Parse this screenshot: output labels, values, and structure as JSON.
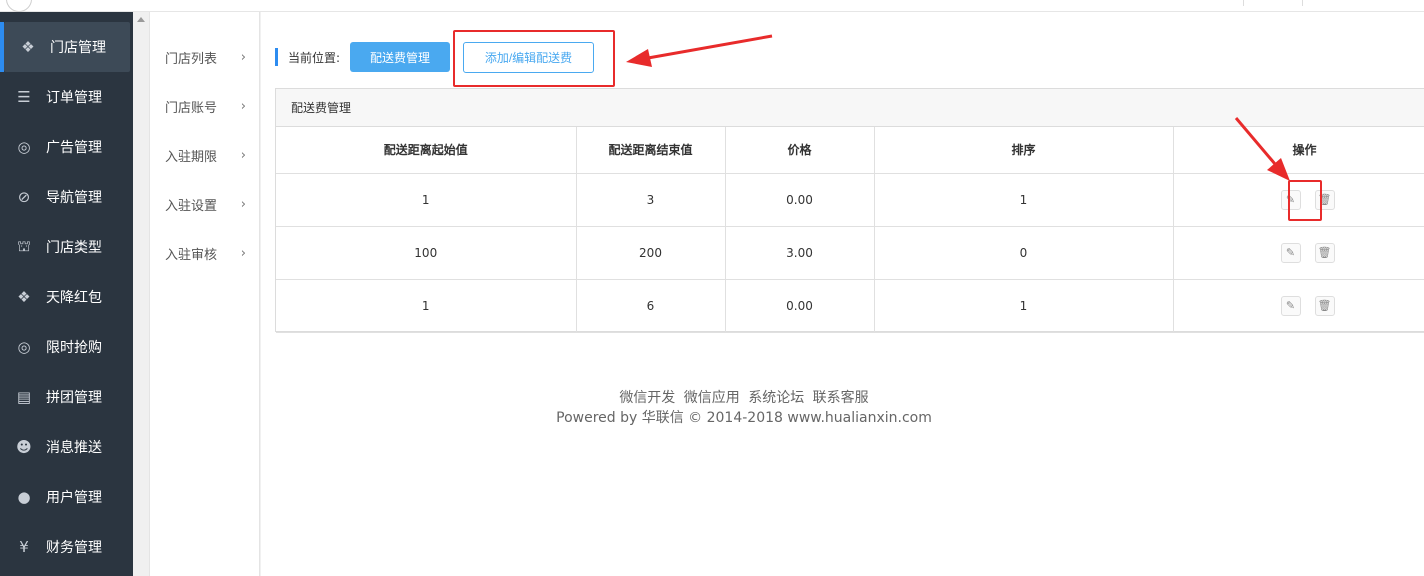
{
  "sidebar": {
    "items": [
      {
        "label": "门店管理",
        "icon": "cubes-icon",
        "glyph": "❖",
        "active": true
      },
      {
        "label": "订单管理",
        "icon": "list-icon",
        "glyph": "☰"
      },
      {
        "label": "广告管理",
        "icon": "lifebuoy-icon",
        "glyph": "◎"
      },
      {
        "label": "导航管理",
        "icon": "compass-icon",
        "glyph": "⊘"
      },
      {
        "label": "门店类型",
        "icon": "bank-icon",
        "glyph": "⛫"
      },
      {
        "label": "天降红包",
        "icon": "cubes-icon",
        "glyph": "❖"
      },
      {
        "label": "限时抢购",
        "icon": "lifebuoy-icon",
        "glyph": "◎"
      },
      {
        "label": "拼团管理",
        "icon": "newspaper-icon",
        "glyph": "▤"
      },
      {
        "label": "消息推送",
        "icon": "users-icon",
        "glyph": "☻"
      },
      {
        "label": "用户管理",
        "icon": "user-icon",
        "glyph": "●"
      },
      {
        "label": "财务管理",
        "icon": "yen-icon",
        "glyph": "¥"
      }
    ]
  },
  "subnav": {
    "items": [
      {
        "label": "门店列表"
      },
      {
        "label": "门店账号"
      },
      {
        "label": "入驻期限"
      },
      {
        "label": "入驻设置"
      },
      {
        "label": "入驻审核"
      }
    ]
  },
  "breadcrumb": {
    "label": "当前位置:",
    "current": "配送费管理",
    "action": "添加/编辑配送费"
  },
  "panel": {
    "title": "配送费管理",
    "columns": [
      "配送距离起始值",
      "配送距离结束值",
      "价格",
      "排序",
      "操作"
    ],
    "rows": [
      {
        "start": "1",
        "end": "3",
        "price": "0.00",
        "sort": "1"
      },
      {
        "start": "100",
        "end": "200",
        "price": "3.00",
        "sort": "0"
      },
      {
        "start": "1",
        "end": "6",
        "price": "0.00",
        "sort": "1"
      }
    ]
  },
  "footer": {
    "links": [
      "微信开发",
      "微信应用",
      "系统论坛",
      "联系客服"
    ],
    "powered": "Powered by 华联信 © 2014-2018 www.hualianxin.com"
  },
  "colors": {
    "sidebar_bg": "#2b3540",
    "primary": "#4aa9f0",
    "highlight": "#e82b2b"
  }
}
